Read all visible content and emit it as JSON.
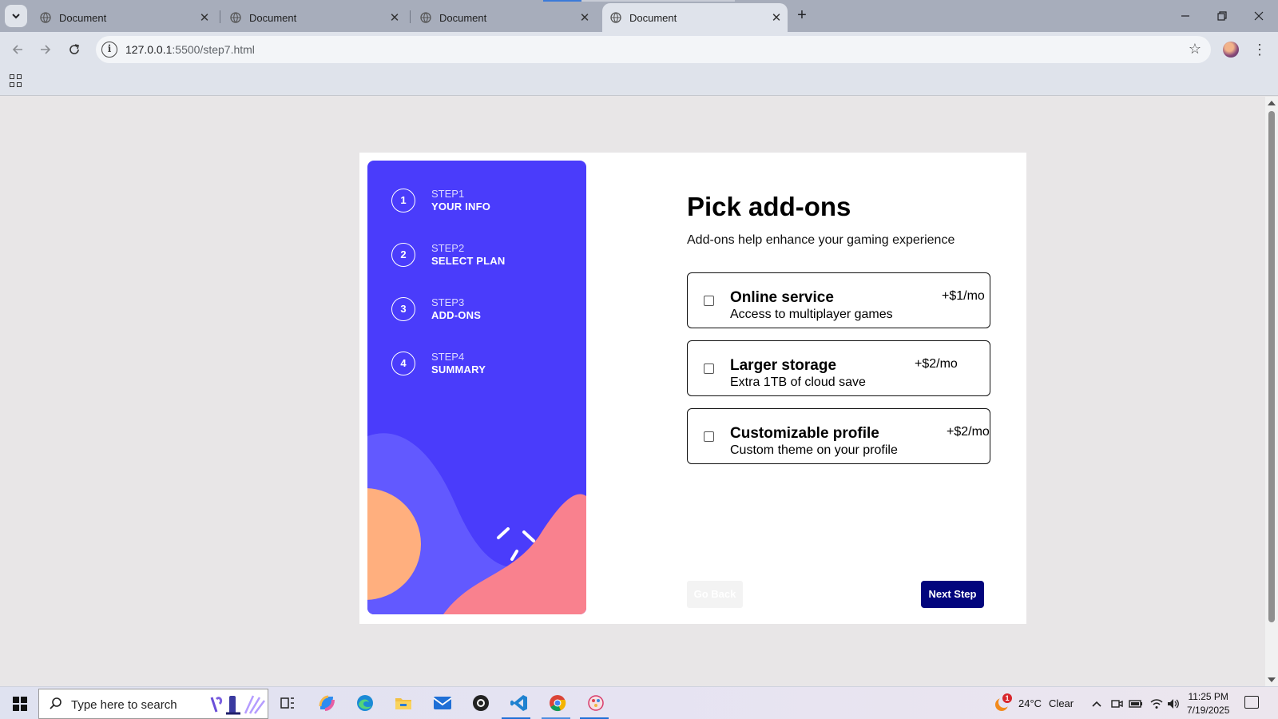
{
  "browser": {
    "tabs": [
      {
        "title": "Document",
        "active": false
      },
      {
        "title": "Document",
        "active": false
      },
      {
        "title": "Document",
        "active": false
      },
      {
        "title": "Document",
        "active": true
      }
    ],
    "address": {
      "host": "127.0.0.1",
      "path": ":5500/step7.html"
    }
  },
  "steps": [
    {
      "number": "1",
      "label": "STEP1",
      "title": "YOUR INFO"
    },
    {
      "number": "2",
      "label": "STEP2",
      "title": "SELECT PLAN"
    },
    {
      "number": "3",
      "label": "STEP3",
      "title": "ADD-ONS"
    },
    {
      "number": "4",
      "label": "STEP4",
      "title": "SUMMARY"
    }
  ],
  "main": {
    "title": "Pick add-ons",
    "subtitle": "Add-ons help enhance your gaming experience",
    "addons": [
      {
        "name": "Online service",
        "description": "Access to multiplayer games",
        "price": "+$1/mo",
        "checked": false
      },
      {
        "name": "Larger storage",
        "description": "Extra 1TB of cloud save",
        "price": "+$2/mo",
        "checked": false
      },
      {
        "name": "Customizable profile",
        "description": "Custom theme on your profile",
        "price": "+$2/mo",
        "checked": false
      }
    ],
    "back_label": "Go Back",
    "next_label": "Next Step"
  },
  "colors": {
    "sidebar": "#4a3cfb",
    "next_button": "#02057d",
    "blob_orange": "#ffaf7e",
    "blob_pink": "#f9818e",
    "blob_violet": "#6259ff"
  },
  "taskbar": {
    "search_placeholder": "Type here to search",
    "weather_temp": "24°C",
    "weather_text": "Clear",
    "weather_badge": "1",
    "time": "11:25 PM",
    "date": "7/19/2025"
  }
}
